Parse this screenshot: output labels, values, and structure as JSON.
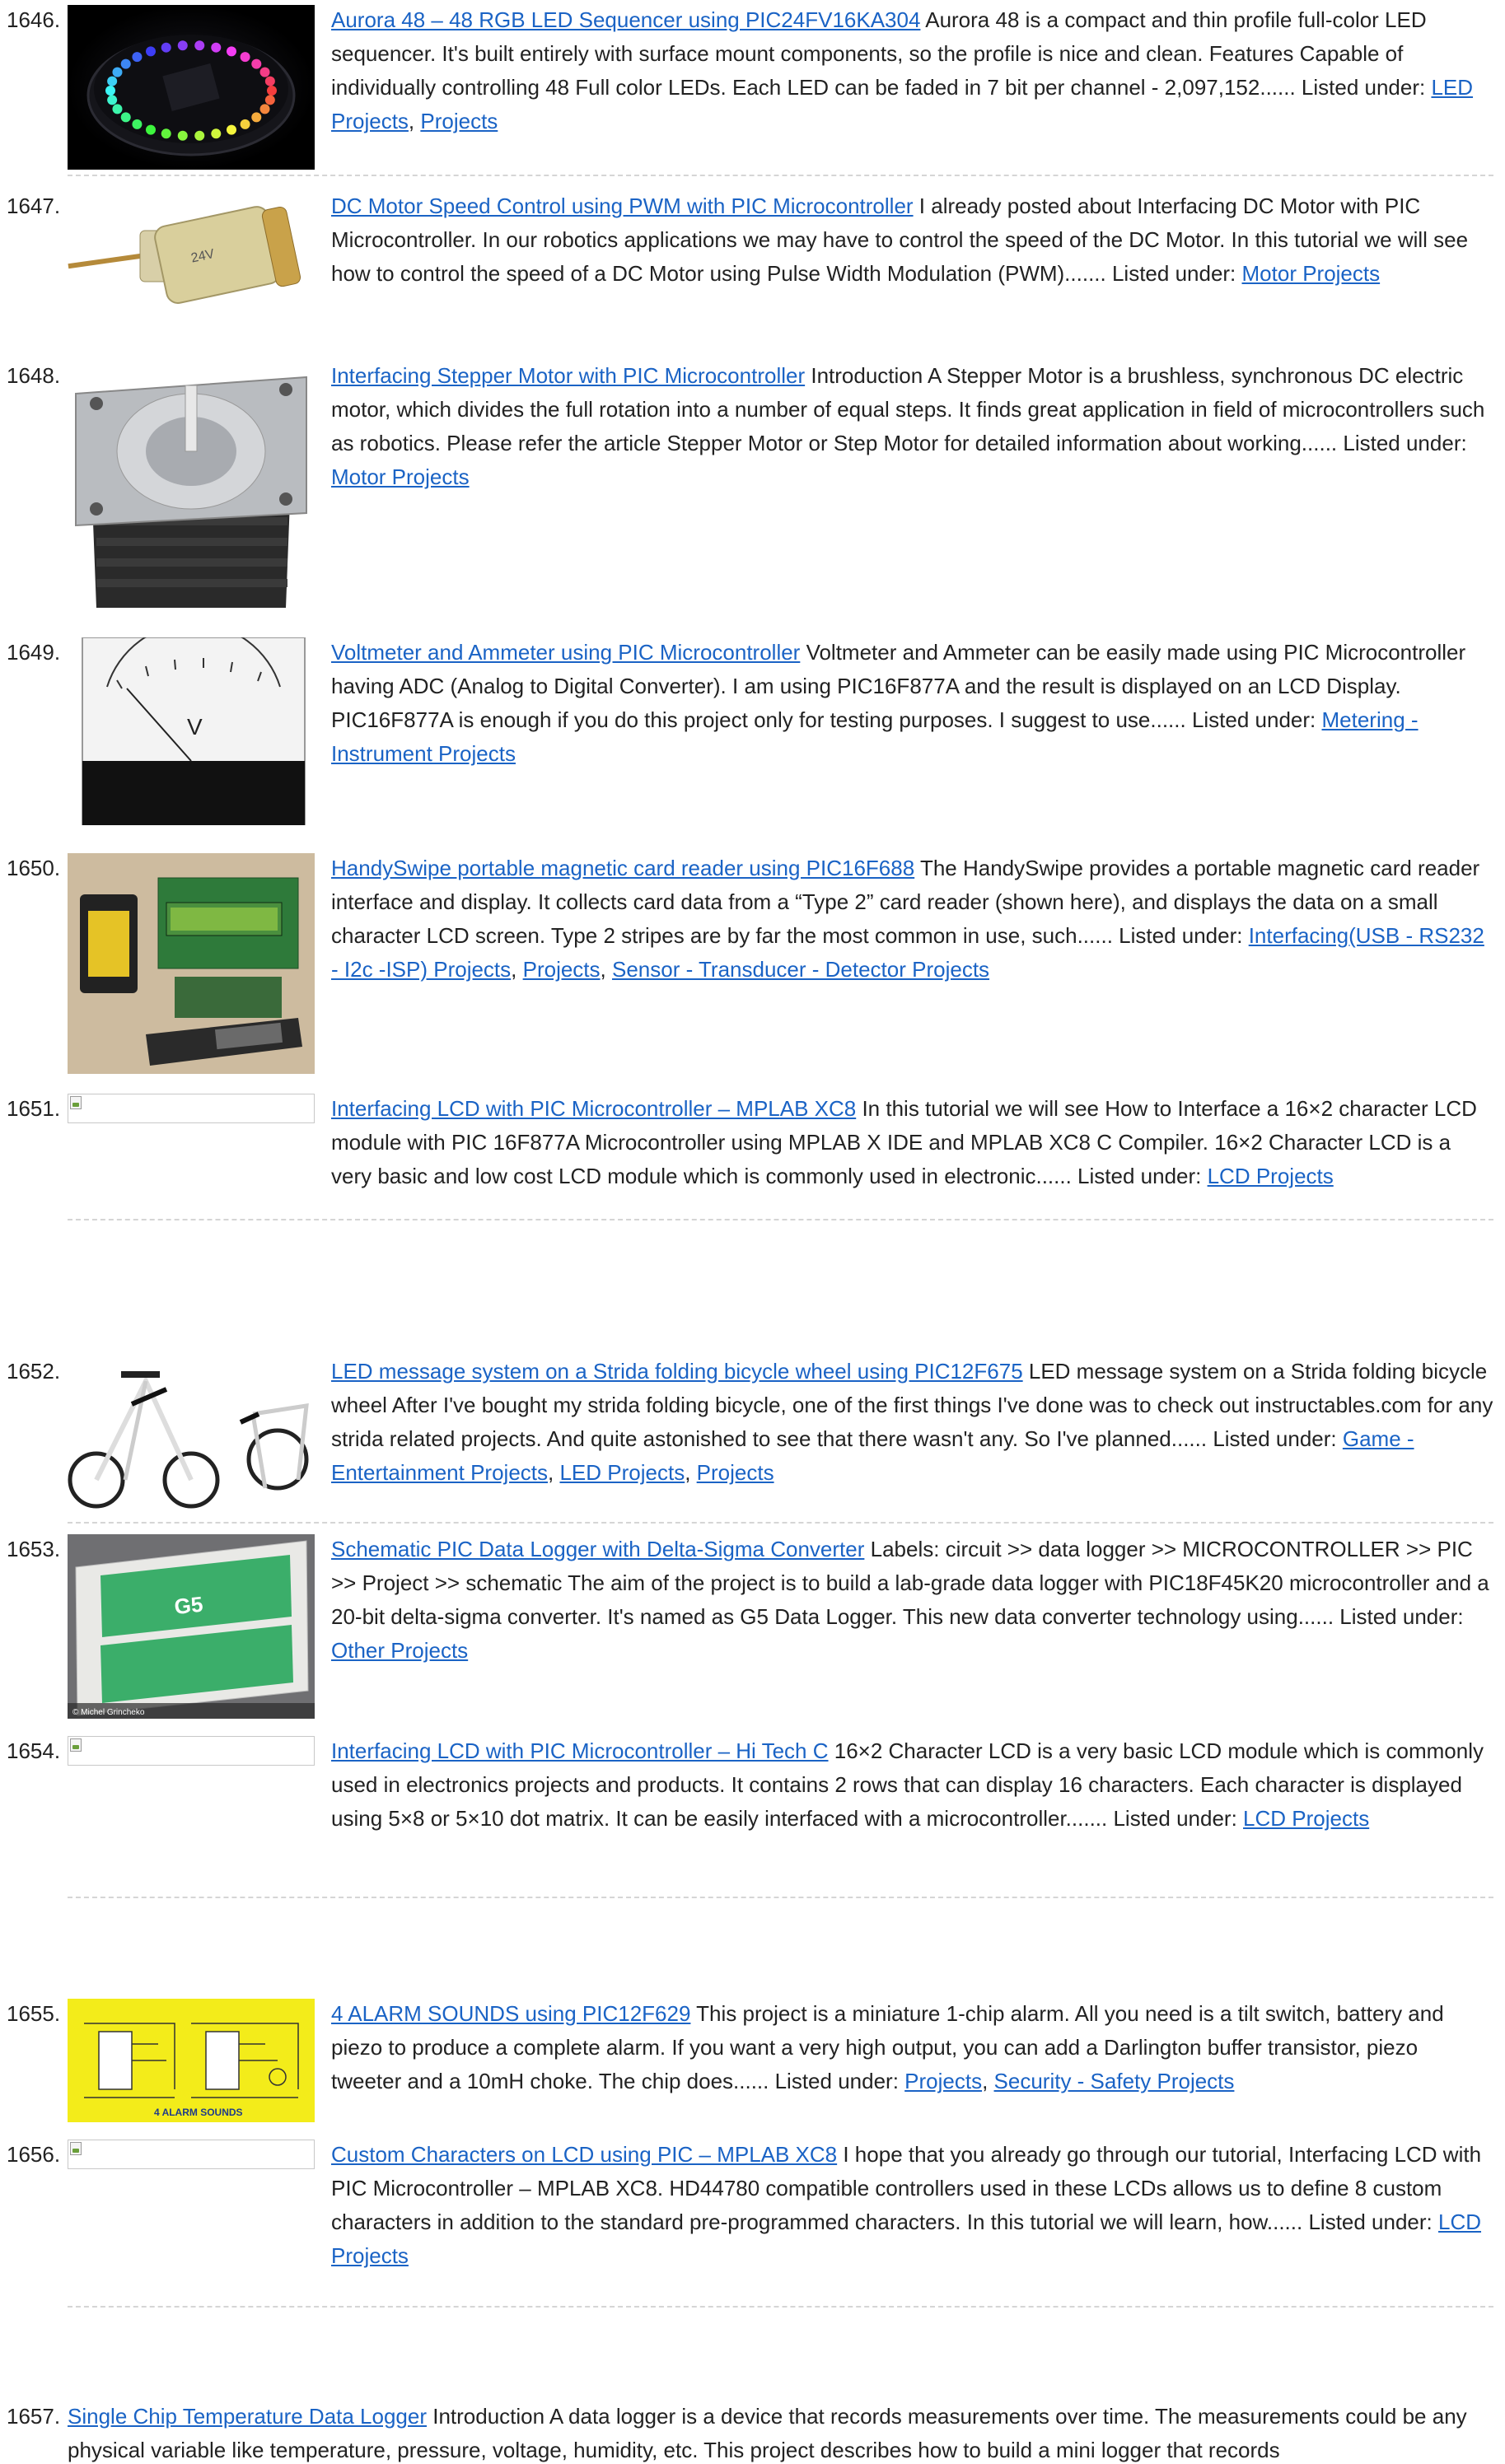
{
  "entries": [
    {
      "num": "1646.",
      "title": "Aurora 48 – 48 RGB LED Sequencer using PIC24FV16KA304",
      "desc": " Aurora 48 is a compact and thin profile full-color LED sequencer. It's built entirely with surface mount components, so the profile is nice and clean. Features Capable of individually controlling 48 Full color LEDs. Each LED can be faded in 7 bit per channel - 2,097,152...... Listed under: ",
      "cats": [
        "LED Projects",
        "Projects"
      ],
      "thumb": "aurora-led-ring-image"
    },
    {
      "num": "1647.",
      "title": "DC Motor Speed Control using PWM with PIC Microcontroller",
      "desc": " I already posted about Interfacing DC Motor with PIC Microcontroller. In our robotics applications we may have to control the speed of the DC Motor. In this tutorial we will see how to control the speed of a DC Motor using Pulse Width Modulation (PWM)....... Listed under: ",
      "cats": [
        "Motor Projects"
      ],
      "thumb": "dc-motor-image"
    },
    {
      "num": "1648.",
      "title": "Interfacing Stepper Motor with PIC Microcontroller",
      "desc": " Introduction A Stepper Motor is a brushless, synchronous DC electric motor, which divides the full rotation into a number of equal steps. It finds great application in field of microcontrollers such as robotics. Please refer the article Stepper Motor or Step Motor for detailed information about working...... Listed under: ",
      "cats": [
        "Motor Projects"
      ],
      "thumb": "stepper-motor-image"
    },
    {
      "num": "1649.",
      "title": "Voltmeter and Ammeter using PIC Microcontroller",
      "desc": " Voltmeter and Ammeter can be easily made using PIC Microcontroller having ADC (Analog to Digital Converter). I am using PIC16F877A and the result is displayed on an LCD Display. PIC16F877A is enough if you do this project only for testing purposes. I suggest to use...... Listed under: ",
      "cats": [
        "Metering - Instrument Projects"
      ],
      "thumb": "voltmeter-image",
      "meter_label": "V"
    },
    {
      "num": "1650.",
      "title": "HandySwipe portable magnetic card reader using PIC16F688",
      "desc": " The HandySwipe provides a portable magnetic card reader interface and display. It collects card data from a “Type 2” card reader (shown here), and displays the data on a small character LCD screen. Type 2 stripes are by far the most common in use, such...... Listed under: ",
      "cats": [
        "Interfacing(USB - RS232 - I2c -ISP) Projects",
        "Projects",
        "Sensor - Transducer - Detector Projects"
      ],
      "thumb": "card-reader-image"
    },
    {
      "num": "1651.",
      "title": "Interfacing LCD with PIC Microcontroller – MPLAB XC8",
      "desc": " In this tutorial we will see How to Interface a 16×2 character LCD module with PIC 16F877A Microcontroller using MPLAB X IDE and MPLAB XC8 C Compiler. 16×2 Character LCD is a very basic and low cost LCD module which is commonly used in electronic...... Listed under: ",
      "cats": [
        "LCD Projects"
      ],
      "thumb": "broken-image"
    },
    {
      "num": "1652.",
      "title": "LED message system on a Strida folding bicycle wheel using PIC12F675",
      "desc": " LED message system on a Strida folding bicycle wheel After I've bought my strida folding bicycle, one of the first things I've done was to check out instructables.com for any strida related projects. And quite astonished to see that there wasn't any. So I've planned...... Listed under: ",
      "cats": [
        "Game - Entertainment Projects",
        "LED Projects",
        "Projects"
      ],
      "thumb": "bicycle-image"
    },
    {
      "num": "1653.",
      "title": "Schematic PIC Data Logger with Delta-Sigma Converter",
      "desc": " Labels: circuit >> data logger >> MICROCONTROLLER >> PIC >> Project >> schematic The aim of the project is to build a lab-grade data logger with PIC18F45K20 microcontroller and a 20-bit delta-sigma converter. It's named as G5 Data Logger. This new data converter technology using...... Listed under: ",
      "cats": [
        "Other Projects"
      ],
      "thumb": "data-logger-board-image",
      "board_label": "G5",
      "credit": "© Michel Grincheko"
    },
    {
      "num": "1654.",
      "title": "Interfacing LCD with PIC Microcontroller – Hi Tech C",
      "desc": " 16×2 Character LCD is a very basic LCD module which is commonly used in electronics projects and products. It contains 2 rows that can display 16 characters. Each character is displayed using 5×8 or 5×10 dot matrix. It can be easily interfaced with a microcontroller....... Listed under: ",
      "cats": [
        "LCD Projects"
      ],
      "thumb": "broken-image"
    },
    {
      "num": "1655.",
      "title": "4 ALARM SOUNDS using PIC12F629",
      "desc": " This project is a miniature 1-chip alarm. All you need is a tilt switch, battery and piezo to produce a complete alarm. If you want a very high output, you can add a Darlington buffer transistor, piezo tweeter and a 10mH choke. The chip does...... Listed under: ",
      "cats": [
        "Projects",
        "Security - Safety Projects"
      ],
      "thumb": "alarm-schematic-image",
      "schematic_label": "4 ALARM SOUNDS"
    },
    {
      "num": "1656.",
      "title": "Custom Characters on LCD using PIC – MPLAB XC8",
      "desc": " I hope that you already go through our tutorial, Interfacing LCD with PIC Microcontroller – MPLAB XC8. HD44780 compatible controllers used in these LCDs allows us to define 8 custom characters in addition to the standard pre-programmed characters. In this tutorial we will learn, how...... Listed under: ",
      "cats": [
        "LCD Projects"
      ],
      "thumb": "broken-image"
    },
    {
      "num": "1657.",
      "title": "Single Chip Temperature Data Logger",
      "desc": " Introduction A data logger is a device that records measurements over time. The measurements could be any physical variable like temperature, pressure, voltage, humidity, etc. This project describes how to build a mini logger that records",
      "cats": [],
      "thumb": "none"
    }
  ],
  "colors": {
    "link": "#1a63c5",
    "text": "#222222",
    "separator": "#d5d5d5"
  }
}
